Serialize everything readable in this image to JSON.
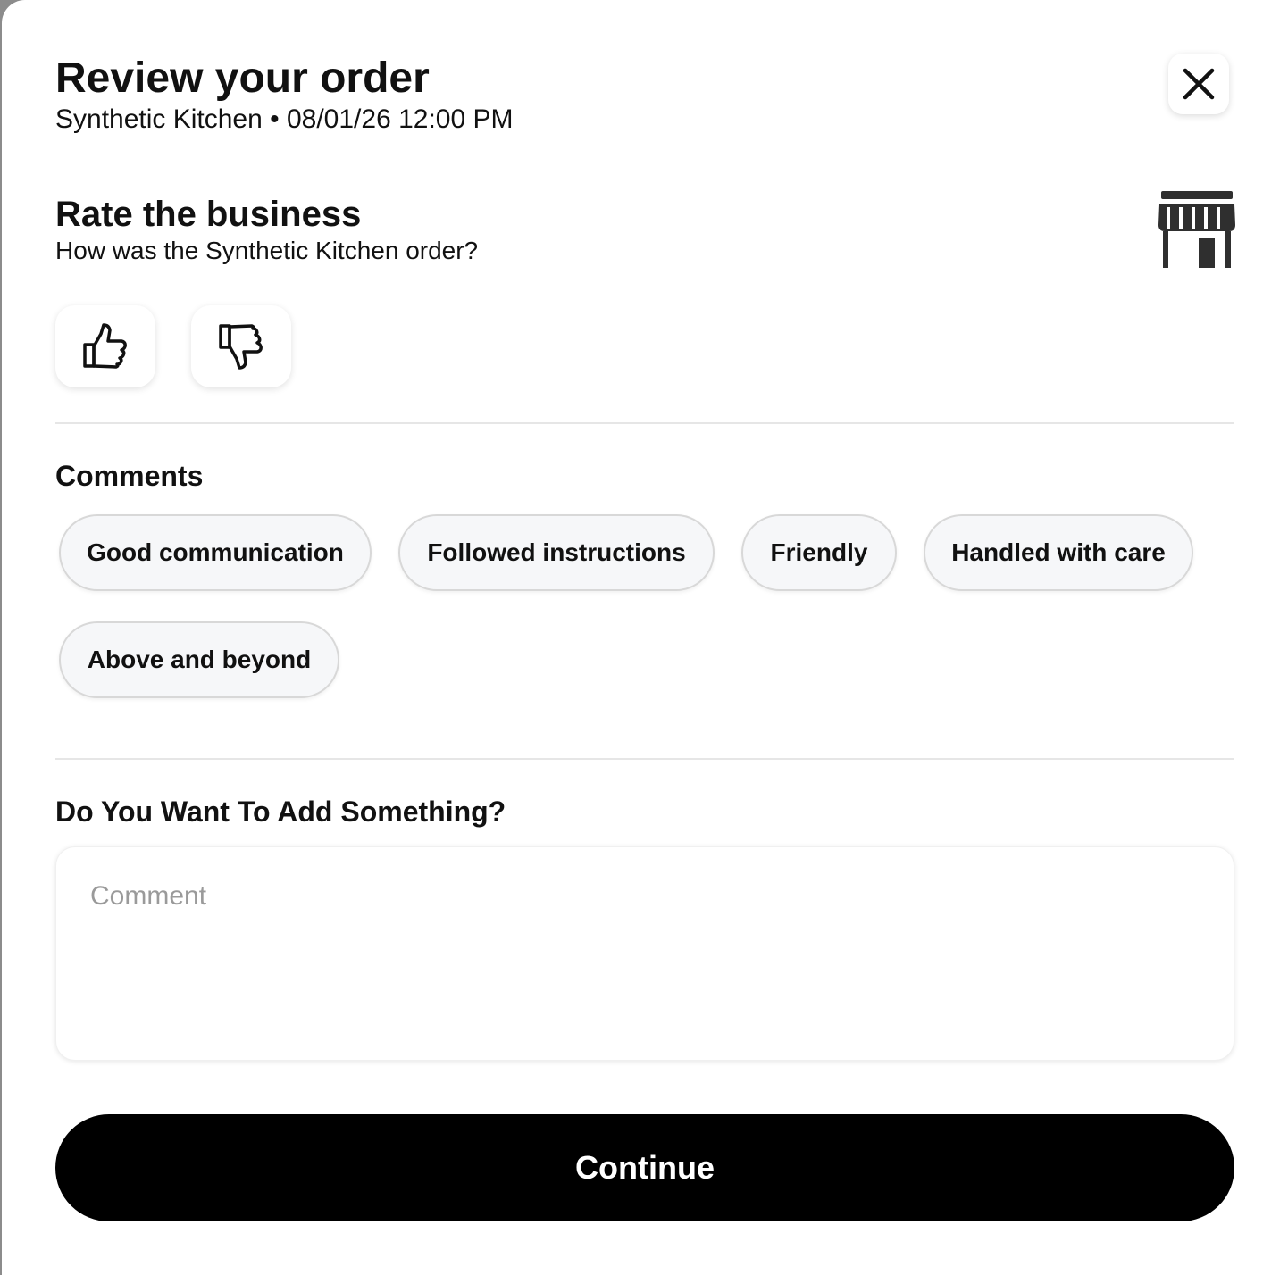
{
  "header": {
    "title": "Review your order",
    "subtitle": "Synthetic Kitchen • 08/01/26 12:00 PM",
    "close_icon": "close-icon"
  },
  "rating": {
    "title": "Rate the business",
    "subtitle": "How was the Synthetic Kitchen order?",
    "store_icon": "store-icon",
    "thumbs_up_icon": "thumbs-up-icon",
    "thumbs_down_icon": "thumbs-down-icon"
  },
  "comments": {
    "label": "Comments",
    "chips": [
      "Good communication",
      "Followed instructions",
      "Friendly",
      "Handled with care",
      "Above and beyond"
    ]
  },
  "add_something": {
    "label": "Do You Want To Add Something?",
    "placeholder": "Comment",
    "value": ""
  },
  "footer": {
    "continue_label": "Continue"
  },
  "colors": {
    "primary_button": "#000000",
    "chip_background": "#f6f7f9",
    "placeholder": "#9a9a9a"
  }
}
